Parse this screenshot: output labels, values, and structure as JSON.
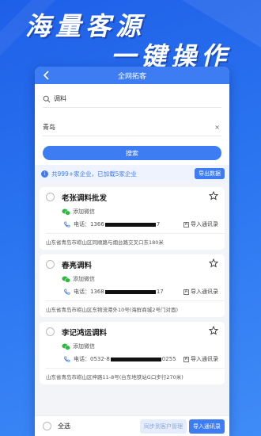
{
  "hero": {
    "line1": "海量客源",
    "line2": "一键操作"
  },
  "navbar": {
    "title": "全网拓客"
  },
  "search": {
    "keyword": "调料",
    "city": "青岛",
    "clear_symbol": "×",
    "button_label": "搜索"
  },
  "info": {
    "icon_text": "i",
    "text": "共999+家企业，已加载5家企业",
    "export_label": "导出数据"
  },
  "labels": {
    "add_wechat": "添加微信",
    "phone_prefix": "电话：",
    "import_label": "导入通讯录",
    "import_box": "A"
  },
  "companies": [
    {
      "name": "老张调料批发",
      "phone_start": "1366",
      "phone_end": "7",
      "address": "山东省青岛市崂山区同顺路与烟台路交叉口东180米"
    },
    {
      "name": "春亮调料",
      "phone_start": "1368",
      "phone_end": "17",
      "address": "山东省青岛市崂山区东物流港外10号(海鲜商城2号门对面)"
    },
    {
      "name": "李记鸿运调料",
      "phone_start": "0532-8",
      "phone_end": "0255",
      "address": "山东省青岛市崂山区梓路11-8号(台东地铁站G口步行270米)"
    }
  ],
  "bottom": {
    "select_all": "全选",
    "sync_label": "同步到客户管理",
    "import_label": "导入通讯录"
  },
  "colors": {
    "primary": "#3d7cf2",
    "background": "#2a74f0",
    "wechat": "#2dbb3f"
  }
}
